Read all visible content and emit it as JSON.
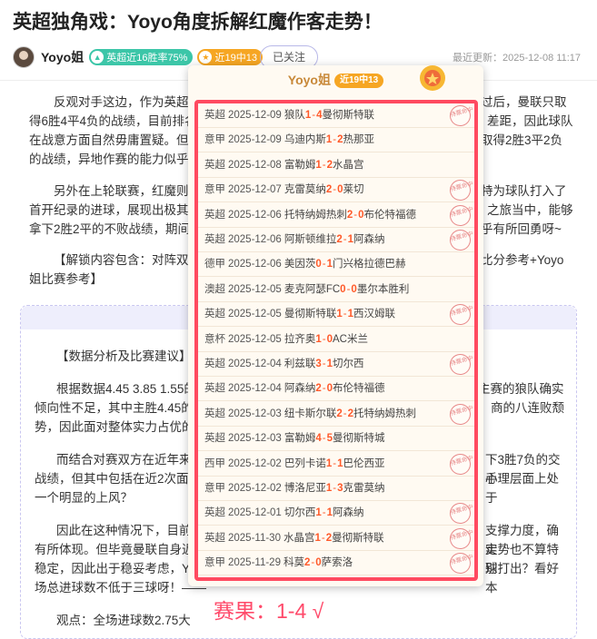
{
  "article": {
    "title": "英超独角戏：Yoyo角度拆解红魔作客走势！",
    "author": "Yoyo姐",
    "badge_streak": "英超近16胜率75%",
    "badge_recent": "近19中13",
    "follow_label": "已关注",
    "updated": "最近更新：2025-12-08 11:17"
  },
  "body": {
    "p1a": "反观对手这边，作为英超传",
    "p1b": "过后，曼联只取",
    "p1c": "得6胜4平4负的战绩，目前排名",
    "p1d": "差距，因此球队",
    "p1e": "在战意方面自然毋庸置疑。但值",
    "p1f": "取得2胜3平2负",
    "p1g": "的战绩，异地作赛的能力似乎相",
    "p2a": "另外在上轮联赛，红魔则在",
    "p2b": "特为球队打入了",
    "p2c": "首开纪录的进球，展现出极其不",
    "p2d": "之旅当中，能够",
    "p2e": "拿下2胜2平的不败战绩，期间每",
    "p2f": "乎有所回勇呀~",
    "p3a": "【解锁内容包含：对阵双方",
    "p3b": "比分参考+Yoyo",
    "p3c": "姐比赛参考】"
  },
  "locked": {
    "heading": "【数据分析及比赛建议】",
    "q1a": "根据数据4.45 3.85 1.55的",
    "q1b": "主赛的狼队确实",
    "q1c": "倾向性不足，其中主胜4.45的数",
    "q1d": "商的八连败颓",
    "q1e": "势，因此面对整体实力占优的曼",
    "q2a": "而结合对赛双方在近年来的",
    "q2b": "下3胜7负的交手",
    "q2c": "战绩，但其中包括在近2次面对",
    "q2d": "心理层面上处于",
    "q2e": "一个明显的上风？",
    "q3a": "因此在这种情况下，目前数",
    "q3b": "支撑力度，确实",
    "q3c": "有所体现。但毕竟曼联自身近期",
    "q3d": "走势也不算特别",
    "q3e": "稳定，因此出于稳妥考虑，Yoy",
    "q3f": "球打出？看好本",
    "q3g": "场总进球数不低于三球呀！——",
    "q4": "观点：全场进球数2.75大"
  },
  "popup": {
    "name": "Yoyo姐",
    "badge": "近19中13",
    "stamp_text": "待票命中",
    "records": [
      {
        "league": "英超",
        "date": "2025-12-09",
        "home": "狼队",
        "hs": "1",
        "as": "4",
        "away": "曼彻斯特联",
        "hit": true
      },
      {
        "league": "意甲",
        "date": "2025-12-09",
        "home": "乌迪内斯",
        "hs": "1",
        "as": "2",
        "away": "热那亚",
        "hit": false
      },
      {
        "league": "英超",
        "date": "2025-12-08",
        "home": "富勒姆",
        "hs": "1",
        "as": "2",
        "away": "水晶宫",
        "hit": false
      },
      {
        "league": "意甲",
        "date": "2025-12-07",
        "home": "克雷莫纳",
        "hs": "2",
        "as": "0",
        "away": "莱切",
        "hit": true
      },
      {
        "league": "英超",
        "date": "2025-12-06",
        "home": "托特纳姆热刺",
        "hs": "2",
        "as": "0",
        "away": "布伦特福德",
        "hit": true
      },
      {
        "league": "英超",
        "date": "2025-12-06",
        "home": "阿斯顿维拉",
        "hs": "2",
        "as": "1",
        "away": "阿森纳",
        "hit": true
      },
      {
        "league": "德甲",
        "date": "2025-12-06",
        "home": "美因茨",
        "hs": "0",
        "as": "1",
        "away": "门兴格拉德巴赫",
        "hit": false
      },
      {
        "league": "澳超",
        "date": "2025-12-05",
        "home": "麦克阿瑟FC",
        "hs": "0",
        "as": "0",
        "away": "墨尔本胜利",
        "hit": false
      },
      {
        "league": "英超",
        "date": "2025-12-05",
        "home": "曼彻斯特联",
        "hs": "1",
        "as": "1",
        "away": "西汉姆联",
        "hit": true
      },
      {
        "league": "意杯",
        "date": "2025-12-05",
        "home": "拉齐奥",
        "hs": "1",
        "as": "0",
        "away": "AC米兰",
        "hit": false
      },
      {
        "league": "英超",
        "date": "2025-12-04",
        "home": "利兹联",
        "hs": "3",
        "as": "1",
        "away": "切尔西",
        "hit": true
      },
      {
        "league": "英超",
        "date": "2025-12-04",
        "home": "阿森纳",
        "hs": "2",
        "as": "0",
        "away": "布伦特福德",
        "hit": false
      },
      {
        "league": "英超",
        "date": "2025-12-03",
        "home": "纽卡斯尔联",
        "hs": "2",
        "as": "2",
        "away": "托特纳姆热刺",
        "hit": true
      },
      {
        "league": "英超",
        "date": "2025-12-03",
        "home": "富勒姆",
        "hs": "4",
        "as": "5",
        "away": "曼彻斯特城",
        "hit": false
      },
      {
        "league": "西甲",
        "date": "2025-12-02",
        "home": "巴列卡诺",
        "hs": "1",
        "as": "1",
        "away": "巴伦西亚",
        "hit": true
      },
      {
        "league": "意甲",
        "date": "2025-12-02",
        "home": "博洛尼亚",
        "hs": "1",
        "as": "3",
        "away": "克雷莫纳",
        "hit": false
      },
      {
        "league": "英超",
        "date": "2025-12-01",
        "home": "切尔西",
        "hs": "1",
        "as": "1",
        "away": "阿森纳",
        "hit": true
      },
      {
        "league": "英超",
        "date": "2025-11-30",
        "home": "水晶宫",
        "hs": "1",
        "as": "2",
        "away": "曼彻斯特联",
        "hit": true
      },
      {
        "league": "意甲",
        "date": "2025-11-29",
        "home": "科莫",
        "hs": "2",
        "as": "0",
        "away": "萨索洛",
        "hit": true
      }
    ]
  },
  "result_text": "赛果：1-4 √"
}
